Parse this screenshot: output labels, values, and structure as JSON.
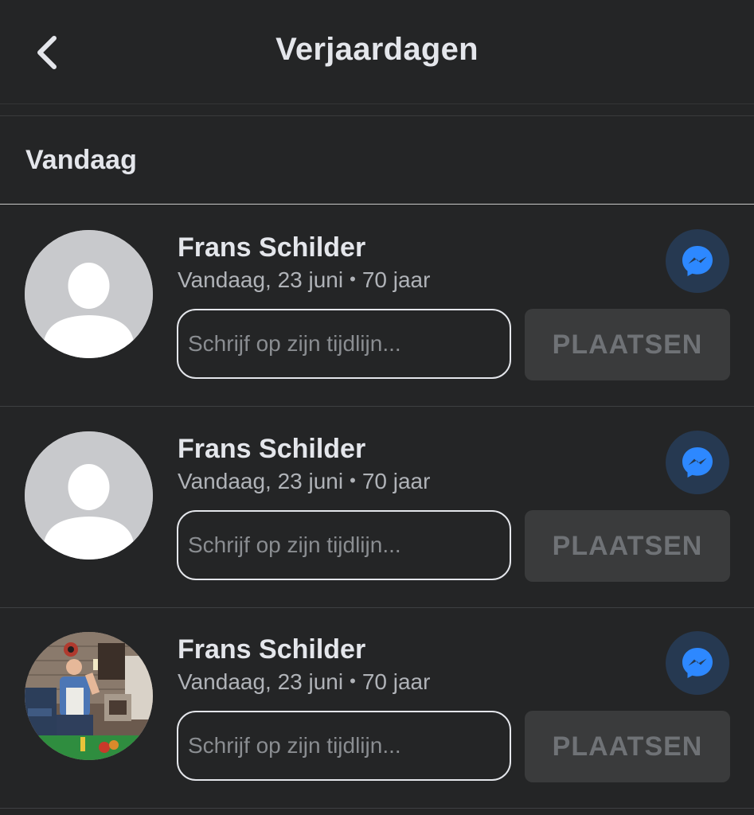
{
  "header": {
    "title": "Verjaardagen",
    "back_icon": "chevron-left-icon"
  },
  "section": {
    "label": "Vandaag"
  },
  "birthdays": [
    {
      "name": "Frans Schilder",
      "date": "Vandaag, 23 juni",
      "separator": "•",
      "age": "70 jaar",
      "avatar": "default-avatar",
      "input_placeholder": "Schrijf op zijn tijdlijn...",
      "post_label": "PLAATSEN",
      "message_icon": "messenger-icon"
    },
    {
      "name": "Frans Schilder",
      "date": "Vandaag, 23 juni",
      "separator": "•",
      "age": "70 jaar",
      "avatar": "default-avatar",
      "input_placeholder": "Schrijf op zijn tijdlijn...",
      "post_label": "PLAATSEN",
      "message_icon": "messenger-icon"
    },
    {
      "name": "Frans Schilder",
      "date": "Vandaag, 23 juni",
      "separator": "•",
      "age": "70 jaar",
      "avatar": "photo-avatar",
      "input_placeholder": "Schrijf op zijn tijdlijn...",
      "post_label": "PLAATSEN",
      "message_icon": "messenger-icon"
    }
  ],
  "colors": {
    "background": "#242526",
    "text_primary": "#e4e6eb",
    "text_secondary": "#b0b3b8",
    "messenger_bg": "#263951",
    "messenger_accent": "#2d88ff",
    "button_bg": "#3a3b3c"
  }
}
